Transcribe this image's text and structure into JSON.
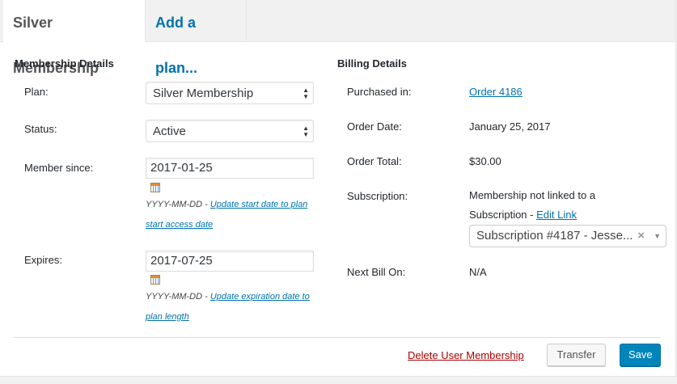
{
  "tabs": {
    "active_label": "Silver Membership",
    "add_label": "Add a plan..."
  },
  "membership": {
    "heading": "Membership Details",
    "plan_label": "Plan:",
    "plan_value": "Silver Membership",
    "status_label": "Status:",
    "status_value": "Active",
    "since_label": "Member since:",
    "since_value": "2017-01-25",
    "since_hint_format": "YYYY-MM-DD - ",
    "since_hint_link": "Update start date to plan start access date",
    "expires_label": "Expires:",
    "expires_value": "2017-07-25",
    "expires_hint_format": "YYYY-MM-DD - ",
    "expires_hint_link": "Update expiration date to plan length"
  },
  "billing": {
    "heading": "Billing Details",
    "purchased_label": "Purchased in:",
    "purchased_value": "Order 4186",
    "order_date_label": "Order Date:",
    "order_date_value": "January 25, 2017",
    "order_total_label": "Order Total:",
    "order_total_value": "$30.00",
    "subscription_label": "Subscription:",
    "subscription_text": "Membership not linked to a Subscription - ",
    "subscription_edit_link": "Edit Link",
    "subscription_select_value": "Subscription #4187 - Jesse...",
    "next_bill_label": "Next Bill On:",
    "next_bill_value": "N/A"
  },
  "actions": {
    "delete_label": "Delete User Membership",
    "transfer_label": "Transfer",
    "save_label": "Save"
  },
  "colors": {
    "link": "#0073aa",
    "delete": "#aa0000",
    "primary": "#0085ba"
  }
}
